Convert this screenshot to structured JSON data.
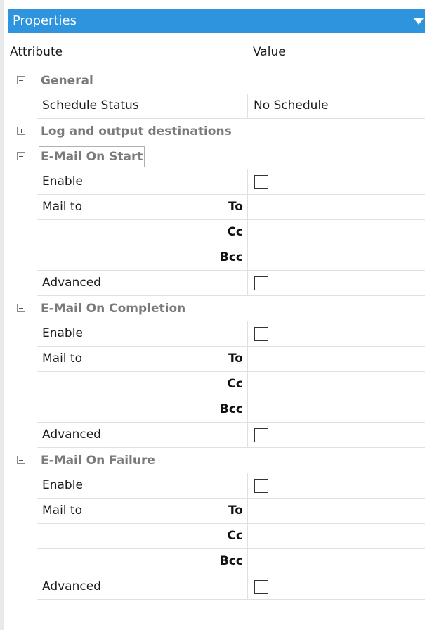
{
  "panel": {
    "title": "Properties",
    "menu_icon": "chevron-down-icon"
  },
  "header": {
    "attribute": "Attribute",
    "value": "Value"
  },
  "general": {
    "title": "General",
    "schedule_status_label": "Schedule Status",
    "schedule_status_value": "No Schedule"
  },
  "log": {
    "title": "Log and output destinations"
  },
  "start": {
    "title": "E-Mail On Start",
    "enable_label": "Enable",
    "enable_checked": false,
    "mailto_label": "Mail to",
    "to": "To",
    "cc": "Cc",
    "bcc": "Bcc",
    "advanced_label": "Advanced",
    "advanced_checked": false
  },
  "completion": {
    "title": "E-Mail On Completion",
    "enable_label": "Enable",
    "enable_checked": false,
    "mailto_label": "Mail to",
    "to": "To",
    "cc": "Cc",
    "bcc": "Bcc",
    "advanced_label": "Advanced",
    "advanced_checked": false
  },
  "failure": {
    "title": "E-Mail On Failure",
    "enable_label": "Enable",
    "enable_checked": false,
    "mailto_label": "Mail to",
    "to": "To",
    "cc": "Cc",
    "bcc": "Bcc",
    "advanced_label": "Advanced",
    "advanced_checked": false
  },
  "colors": {
    "titlebar": "#2d94dd",
    "section_text": "#7a7a7a"
  }
}
